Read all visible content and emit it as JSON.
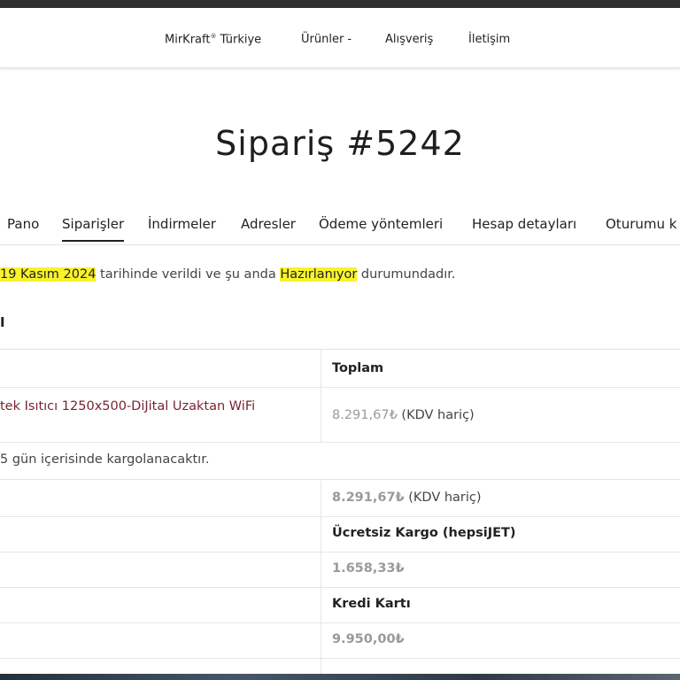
{
  "nav": {
    "brand": "MirKraft",
    "brand_mark": "®",
    "brand_suffix": " Türkiye",
    "items": [
      {
        "label": "Ürünler -"
      },
      {
        "label": "Alışveriş"
      },
      {
        "label": "İletişim"
      }
    ]
  },
  "page": {
    "title": "Sipariş #5242"
  },
  "tabs": [
    {
      "label": "Pano"
    },
    {
      "label": "Siparişler"
    },
    {
      "label": "İndirmeler"
    },
    {
      "label": "Adresler"
    },
    {
      "label": "Ödeme yöntemleri"
    },
    {
      "label": "Hesap detayları"
    },
    {
      "label": "Oturumu k"
    }
  ],
  "order_status": {
    "date": "19 Kasım 2024",
    "text_middle": " tarihinde verildi ve şu anda ",
    "status": "Hazırlanıyor",
    "text_end": " durumundadır."
  },
  "section_heading": "I",
  "table": {
    "header_total": "Toplam",
    "product_name": "tek Isıtıcı 1250x500-DiJital Uzaktan WiFi",
    "product_total": "8.291,67₺",
    "product_tax_note": " (KDV hariç)",
    "shipping_note": "5 gün içerisinde kargolanacaktır.",
    "subtotal_value": "8.291,67₺",
    "subtotal_tax_note": " (KDV hariç)",
    "shipping_value": "Ücretsiz Kargo (hepsiJET)",
    "tax_value": "1.658,33₺",
    "payment_value": "Kredi Kartı",
    "total_value": "9.950,00₺"
  }
}
